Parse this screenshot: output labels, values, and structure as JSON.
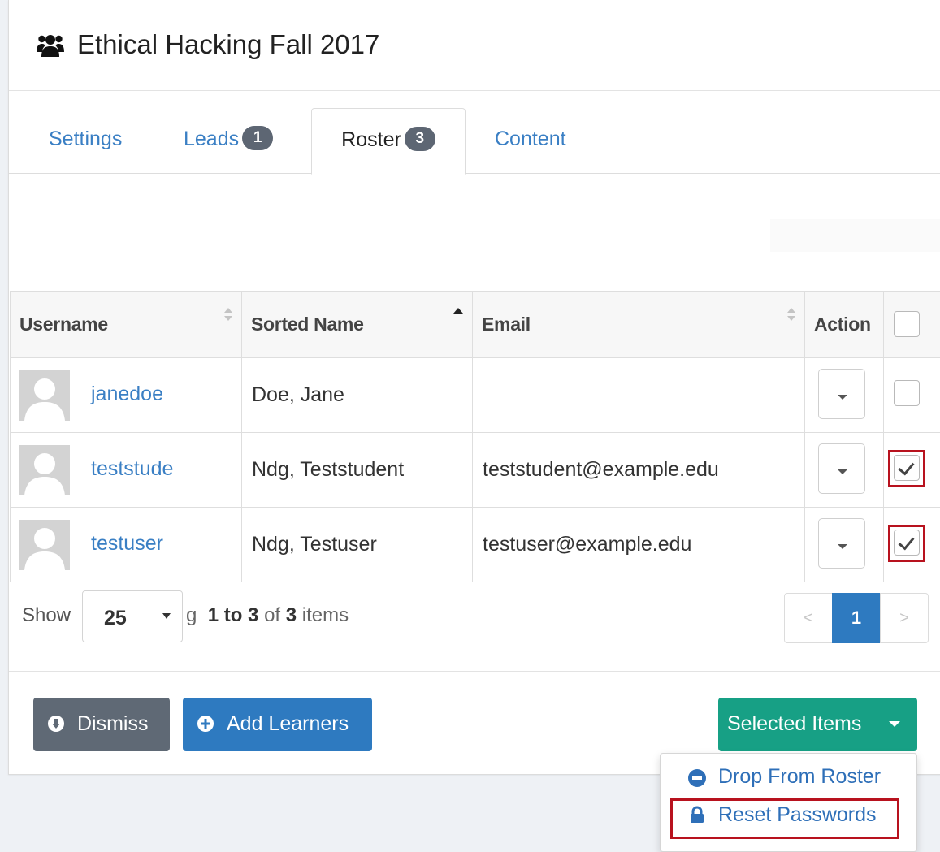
{
  "header": {
    "title": "Ethical Hacking Fall 2017",
    "icon": "users-icon"
  },
  "tabs": [
    {
      "label": "Settings"
    },
    {
      "label": "Leads",
      "badge": "1"
    },
    {
      "label": "Roster",
      "badge": "3",
      "active": true
    },
    {
      "label": "Content"
    }
  ],
  "table": {
    "columns": [
      "Username",
      "Sorted Name",
      "Email",
      "Action"
    ],
    "rows": [
      {
        "username": "janedoe",
        "sorted_name": "Doe, Jane",
        "email": "",
        "checked": false
      },
      {
        "username": "teststude",
        "sorted_name": "Ndg, Teststudent",
        "email": "teststudent@example.edu",
        "checked": true
      },
      {
        "username": "testuser",
        "sorted_name": "Ndg, Testuser",
        "email": "testuser@example.edu",
        "checked": true
      }
    ]
  },
  "footer": {
    "show_label": "Show",
    "page_size": "25",
    "info_prefix": "g",
    "info_range": "1 to 3",
    "info_of": "of",
    "info_total": "3",
    "info_suffix": "items",
    "pager": {
      "prev": "<",
      "current": "1",
      "next": ">"
    }
  },
  "buttons": {
    "dismiss": "Dismiss",
    "add_learners": "Add Learners",
    "selected_items": "Selected Items"
  },
  "menu": {
    "drop": "Drop From Roster",
    "reset": "Reset Passwords"
  },
  "colors": {
    "link": "#3a7fc4",
    "primary": "#2e7ac0",
    "success": "#17a085",
    "secondary": "#5f6975",
    "highlight": "#b8121e"
  }
}
